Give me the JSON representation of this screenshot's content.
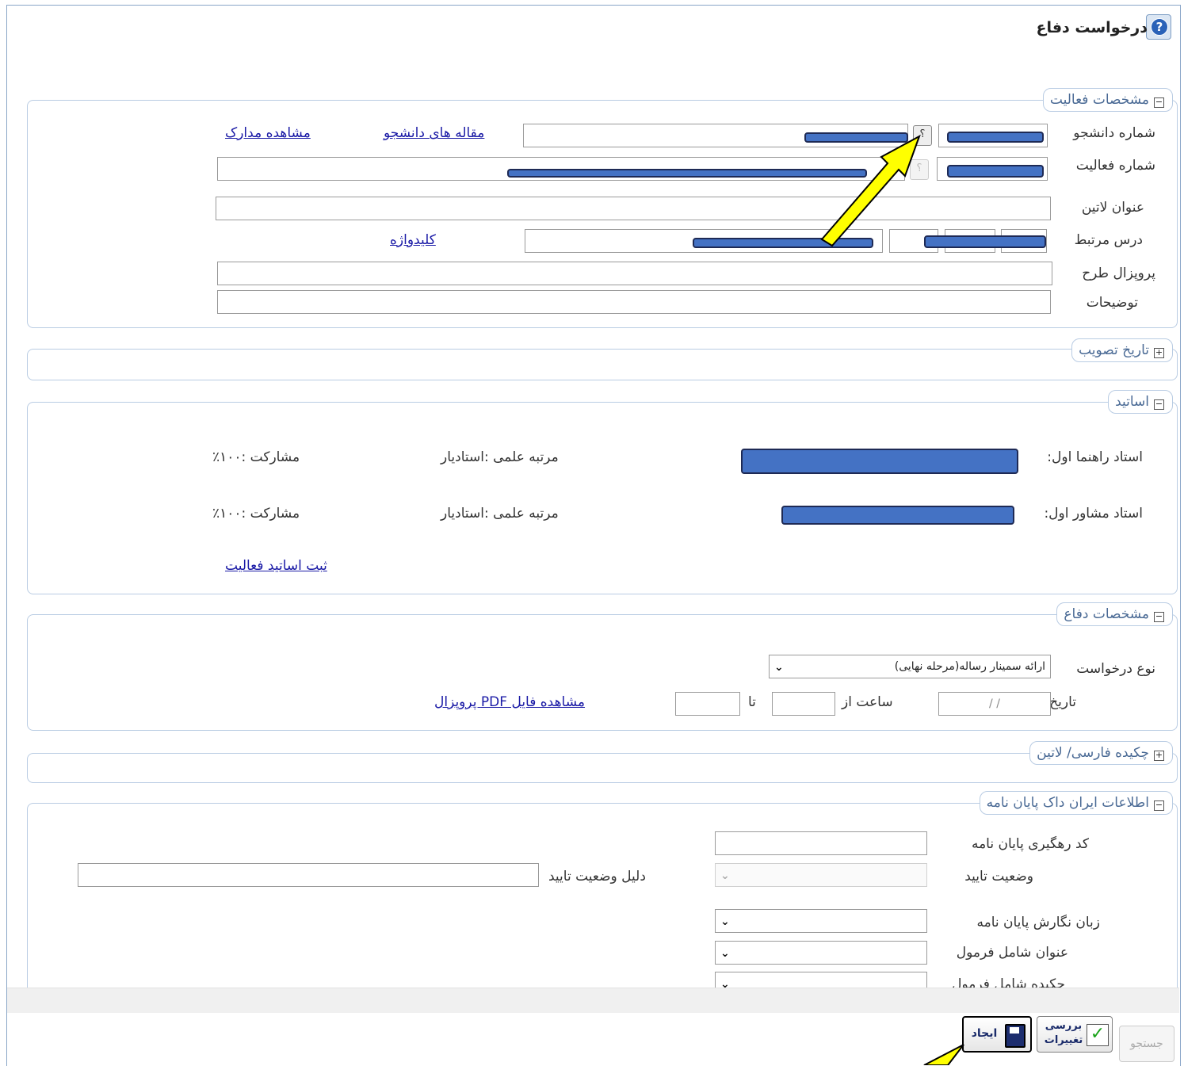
{
  "page": {
    "title": "درخواست دفاع"
  },
  "activity": {
    "legend": "مشخصات فعالیت",
    "student_number_label": "شماره دانشجو",
    "activity_number_label": "شماره فعالیت",
    "latin_title_label": "عنوان لاتین",
    "related_course_label": "درس مرتبط",
    "proposal_label": "پروپزال طرح",
    "description_label": "توضیحات",
    "student_articles_link": "مقاله های دانشجو",
    "view_documents_link": "مشاهده مدارک",
    "keyword_link": "کلیدواژه",
    "lookup_glyph": "؟"
  },
  "approval_date": {
    "legend": "تاریخ تصویب"
  },
  "professors": {
    "legend": "اساتید",
    "rows": [
      {
        "role": "استاد راهنما اول:",
        "rank": "مرتبه علمی :استادیار",
        "share": "مشارکت :۱۰۰٪"
      },
      {
        "role": "استاد مشاور اول:",
        "rank": "مرتبه علمی :استادیار",
        "share": "مشارکت :۱۰۰٪"
      }
    ],
    "register_link": "ثبت اساتید فعالیت"
  },
  "defense": {
    "legend": "مشخصات دفاع",
    "request_type_label": "نوع درخواست",
    "request_type_value": "ارائه سمینار رساله(مرحله نهایی)",
    "date_label": "تاریخ",
    "date_value": "/     /",
    "time_from_label": "ساعت از",
    "time_to_label": "تا",
    "pdf_link": "مشاهده فایل PDF پروپزال"
  },
  "abstract": {
    "legend": "چکیده فارسی/ لاتین"
  },
  "irandoc": {
    "legend": "اطلاعات ایران داک پایان نامه",
    "tracking_code_label": "کد رهگیری پایان نامه",
    "approval_status_label": "وضعیت تایید",
    "approval_reason_label": "دلیل وضعیت تایید",
    "language_label": "زبان نگارش پایان نامه",
    "title_formula_label": "عنوان شامل فرمول",
    "abstract_formula_label": "چکیده شامل فرمول"
  },
  "buttons": {
    "create": "ایجاد",
    "review_top": "بررسی",
    "review_bottom": "تغییرات",
    "search": "جستجو"
  },
  "colors": {
    "redaction": "#4472c4",
    "annotation_arrow": "#ffff00",
    "legend_text": "#4a6a95"
  }
}
